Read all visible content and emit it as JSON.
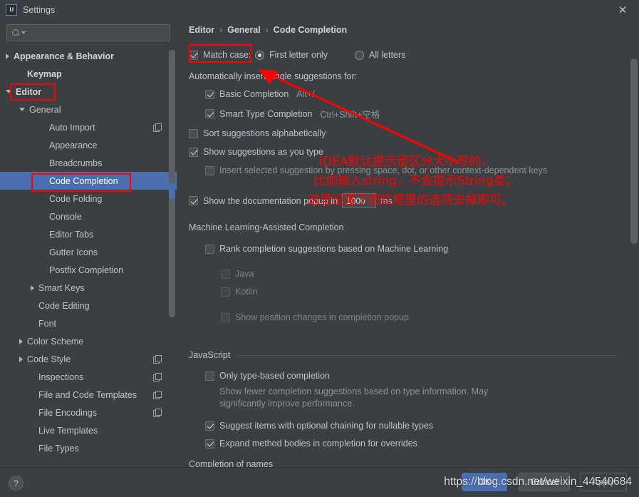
{
  "window": {
    "title": "Settings",
    "app_icon": "intellij-idea-icon",
    "close_label": "✕"
  },
  "sidebar": {
    "search": {
      "placeholder": "",
      "value": ""
    },
    "items": [
      {
        "label": "Appearance & Behavior",
        "indent": 8,
        "twisty": "right",
        "bold": true,
        "copy": false,
        "selected": false
      },
      {
        "label": "Keymap",
        "indent": 27,
        "twisty": "none",
        "bold": true,
        "copy": false,
        "selected": false
      },
      {
        "label": "Editor",
        "indent": 8,
        "twisty": "down",
        "bold": true,
        "copy": false,
        "selected": false
      },
      {
        "label": "General",
        "indent": 27,
        "twisty": "down",
        "bold": false,
        "copy": false,
        "selected": false
      },
      {
        "label": "Auto Import",
        "indent": 58,
        "twisty": "none",
        "bold": false,
        "copy": true,
        "selected": false
      },
      {
        "label": "Appearance",
        "indent": 58,
        "twisty": "none",
        "bold": false,
        "copy": false,
        "selected": false
      },
      {
        "label": "Breadcrumbs",
        "indent": 58,
        "twisty": "none",
        "bold": false,
        "copy": false,
        "selected": false
      },
      {
        "label": "Code Completion",
        "indent": 58,
        "twisty": "none",
        "bold": false,
        "copy": false,
        "selected": true
      },
      {
        "label": "Code Folding",
        "indent": 58,
        "twisty": "none",
        "bold": false,
        "copy": false,
        "selected": false
      },
      {
        "label": "Console",
        "indent": 58,
        "twisty": "none",
        "bold": false,
        "copy": false,
        "selected": false
      },
      {
        "label": "Editor Tabs",
        "indent": 58,
        "twisty": "none",
        "bold": false,
        "copy": false,
        "selected": false
      },
      {
        "label": "Gutter Icons",
        "indent": 58,
        "twisty": "none",
        "bold": false,
        "copy": false,
        "selected": false
      },
      {
        "label": "Postfix Completion",
        "indent": 58,
        "twisty": "none",
        "bold": false,
        "copy": false,
        "selected": false
      },
      {
        "label": "Smart Keys",
        "indent": 43,
        "twisty": "right",
        "bold": false,
        "copy": false,
        "selected": false
      },
      {
        "label": "Code Editing",
        "indent": 43,
        "twisty": "none",
        "bold": false,
        "copy": false,
        "selected": false
      },
      {
        "label": "Font",
        "indent": 43,
        "twisty": "none",
        "bold": false,
        "copy": false,
        "selected": false
      },
      {
        "label": "Color Scheme",
        "indent": 27,
        "twisty": "right",
        "bold": false,
        "copy": false,
        "selected": false
      },
      {
        "label": "Code Style",
        "indent": 27,
        "twisty": "right",
        "bold": false,
        "copy": true,
        "selected": false
      },
      {
        "label": "Inspections",
        "indent": 43,
        "twisty": "none",
        "bold": false,
        "copy": true,
        "selected": false
      },
      {
        "label": "File and Code Templates",
        "indent": 43,
        "twisty": "none",
        "bold": false,
        "copy": true,
        "selected": false
      },
      {
        "label": "File Encodings",
        "indent": 43,
        "twisty": "none",
        "bold": false,
        "copy": true,
        "selected": false
      },
      {
        "label": "Live Templates",
        "indent": 43,
        "twisty": "none",
        "bold": false,
        "copy": false,
        "selected": false
      },
      {
        "label": "File Types",
        "indent": 43,
        "twisty": "none",
        "bold": false,
        "copy": false,
        "selected": false
      }
    ]
  },
  "breadcrumb": {
    "parts": [
      "Editor",
      "General",
      "Code Completion"
    ],
    "separator": "›"
  },
  "settings": {
    "match_case": {
      "label": "Match case:",
      "checked": true,
      "options": [
        {
          "label": "First letter only",
          "selected": true
        },
        {
          "label": "All letters",
          "selected": false
        }
      ]
    },
    "auto_insert_header": "Automatically insert single suggestions for:",
    "basic_completion": {
      "label": "Basic Completion",
      "shortcut": "Alt+/",
      "checked": true
    },
    "smart_type_completion": {
      "label": "Smart Type Completion",
      "shortcut": "Ctrl+Shift+空格",
      "checked": true
    },
    "sort_alphabetically": {
      "label": "Sort suggestions alphabetically",
      "checked": false
    },
    "show_as_you_type": {
      "label": "Show suggestions as you type",
      "checked": true
    },
    "insert_selected": {
      "label": "Insert selected suggestion by pressing space, dot, or other context-dependent keys",
      "checked": false
    },
    "doc_popup": {
      "prefix": "Show the documentation popup in",
      "value": "1000",
      "suffix": "ms",
      "checked": true
    },
    "ml_section": "Machine Learning-Assisted Completion",
    "ml_rank": {
      "label": "Rank completion suggestions based on Machine Learning",
      "checked": false
    },
    "ml_java": {
      "label": "Java",
      "checked": false
    },
    "ml_kotlin": {
      "label": "Kotlin",
      "checked": false
    },
    "ml_position": {
      "label": "Show position changes in completion popup",
      "checked": false
    },
    "javascript_section": "JavaScript",
    "js_type_based": {
      "label": "Only type-based completion",
      "checked": false
    },
    "js_type_based_desc_1": "Show fewer completion suggestions based on type information. May",
    "js_type_based_desc_2": "significantly improve performance.",
    "js_optional_chaining": {
      "label": "Suggest items with optional chaining for nullable types",
      "checked": true
    },
    "js_expand_bodies": {
      "label": "Expand method bodies in completion for overrides",
      "checked": true
    },
    "completion_of_names": "Completion of names"
  },
  "annotation": {
    "line1": "IDEA默认提示是区分大小写的，",
    "line2": "比如输入string，不会提示String类；",
    "line3": "这里设置下把红框里的选项去掉即可。",
    "color": "#ff0000"
  },
  "footer": {
    "help_label": "?",
    "ok_label": "OK",
    "cancel_label": "Cancel",
    "apply_label": "Apply",
    "watermark": "https://blog.csdn.net/weixin_44540684"
  }
}
